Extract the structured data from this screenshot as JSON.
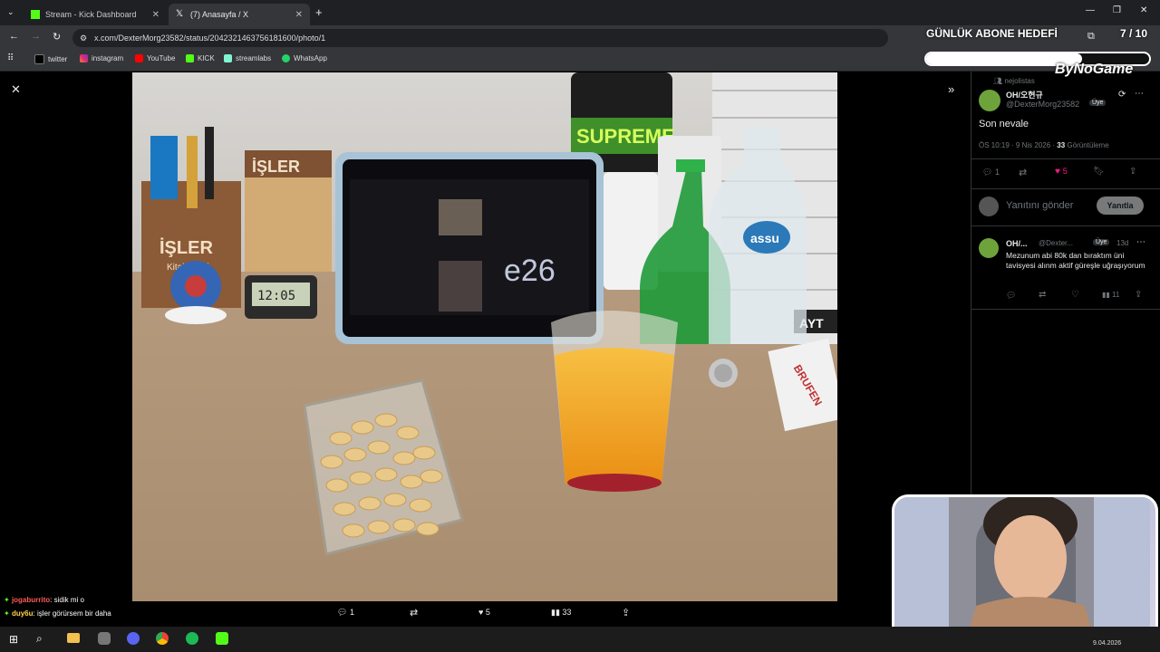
{
  "browser": {
    "tabs": [
      {
        "label": "Stream - Kick Dashboard"
      },
      {
        "label": "(7) Anasayfa / X"
      }
    ],
    "url": "x.com/DexterMorg23582/status/2042321463756181600/photo/1",
    "bookmarks": [
      "twitter",
      "instagram",
      "YouTube",
      "KICK",
      "streamlabs",
      "WhatsApp"
    ]
  },
  "overlay": {
    "goal_title": "GÜNLÜK ABONE HEDEFİ",
    "goal_count": "7 / 10",
    "goal_fraction": 0.7,
    "brand": "ByNoGame"
  },
  "photo_bar": {
    "replies": "1",
    "likes": "5",
    "views": "33"
  },
  "tweet": {
    "list_label": "nejolistas",
    "display_name": "OH/오현규",
    "handle": "@DexterMorg23582",
    "badge": "Üye",
    "text": "Son nevale",
    "time": "ÖS 10:19 · 9 Nis 2026 ·",
    "views": "33",
    "views_label": "Görüntüleme",
    "replies": "1",
    "likes": "5",
    "reply_placeholder": "Yanıtını gönder",
    "reply_button": "Yanıtla"
  },
  "reply": {
    "display_name": "OH/...",
    "handle": "@Dexter...",
    "badge": "Üye",
    "age": "13d",
    "text": "Mezunum abi 80k dan bıraktım üni tavisyesi alınm aktif güreşle uğraşıyorum",
    "views": "11"
  },
  "chat": [
    {
      "user": "jogaburrito",
      "msg": ": sidik mi o"
    },
    {
      "user": "duy6u",
      "msg": ": işler görürsem bir daha"
    }
  ],
  "taskbar": {
    "date": "9.04.2026"
  },
  "photo_scene": {
    "clock": "12:05",
    "shop_name": "İŞLER",
    "shop_sub": "Kitabevleri",
    "books": "AYT",
    "pills": "BRUFEN",
    "bottle": "assu"
  },
  "colors": {
    "like": "#f91880",
    "accent": "#53fc18"
  }
}
